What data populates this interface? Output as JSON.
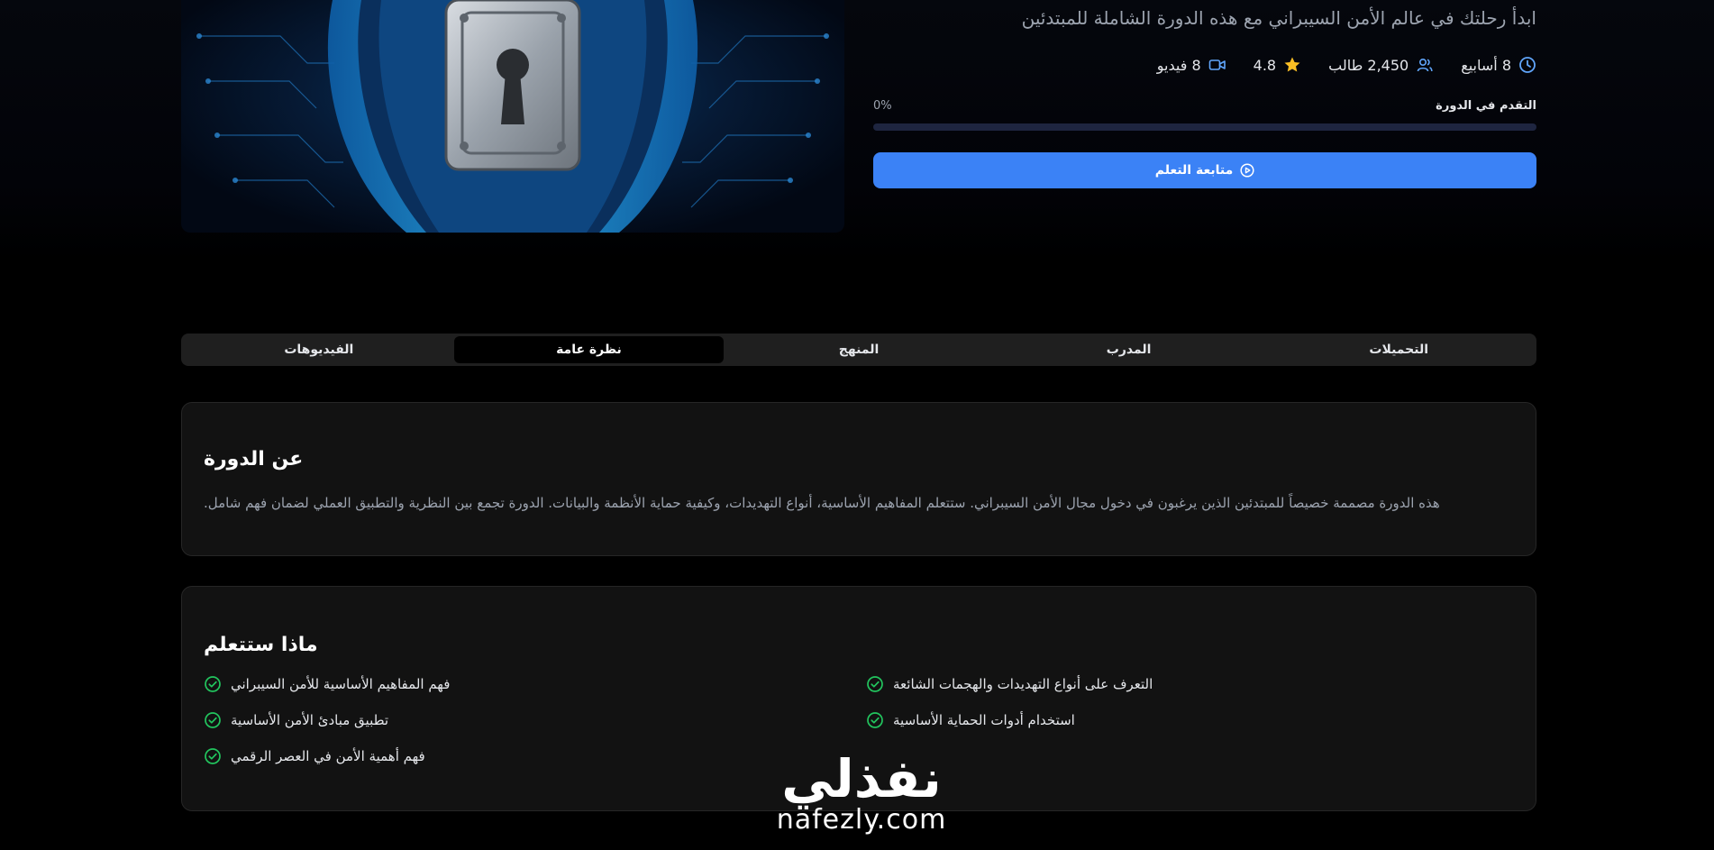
{
  "course": {
    "subtitle": "ابدأ رحلتك في عالم الأمن السيبراني مع هذه الدورة الشاملة للمبتدئين",
    "cover_icon": "shield-padlock-image",
    "meta": {
      "duration": "8 أسابيع",
      "students": "2,450 طالب",
      "rating": "4.8",
      "videos": "8 فيديو"
    },
    "progress": {
      "label": "التقدم في الدورة",
      "value_text": "0%",
      "value": 0
    },
    "cta_label": "متابعة التعلم"
  },
  "tabs": [
    {
      "label": "التحميلات",
      "active": false
    },
    {
      "label": "المدرب",
      "active": false
    },
    {
      "label": "المنهج",
      "active": false
    },
    {
      "label": "نظرة عامة",
      "active": true
    },
    {
      "label": "الفيديوهات",
      "active": false
    }
  ],
  "about": {
    "title": "عن الدورة",
    "text": "هذه الدورة مصممة خصيصاً للمبتدئين الذين يرغبون في دخول مجال الأمن السيبراني. ستتعلم المفاهيم الأساسية، أنواع التهديدات، وكيفية حماية الأنظمة والبيانات. الدورة تجمع بين النظرية والتطبيق العملي لضمان فهم شامل."
  },
  "learn": {
    "title": "ماذا ستتعلم",
    "items": [
      "فهم المفاهيم الأساسية للأمن السيبراني",
      "التعرف على أنواع التهديدات والهجمات الشائعة",
      "تطبيق مبادئ الأمن الأساسية",
      "استخدام أدوات الحماية الأساسية",
      "فهم أهمية الأمن في العصر الرقمي"
    ]
  },
  "watermark": {
    "arabic": "نفذلي",
    "latin": "nafezly.com"
  },
  "colors": {
    "accent": "#3b82f6",
    "check": "#22c55e",
    "star": "#fbbf24",
    "background": "#000000",
    "card": "#121212"
  }
}
